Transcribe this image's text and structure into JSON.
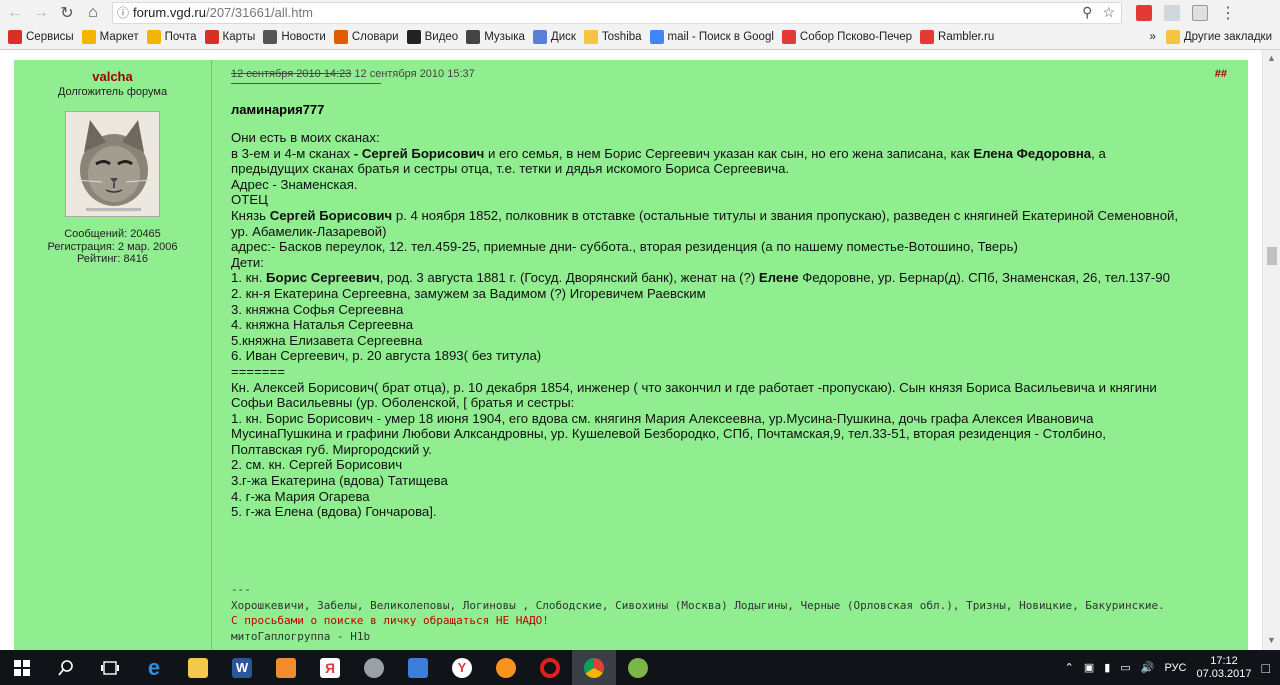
{
  "browser": {
    "url_host": "forum.vgd.ru",
    "url_path": "/207/31661/all.htm"
  },
  "bookmarks": [
    {
      "label": "Сервисы",
      "color": "#d93025"
    },
    {
      "label": "Маркет",
      "color": "#f4b400"
    },
    {
      "label": "Почта",
      "color": "#f4b400"
    },
    {
      "label": "Карты",
      "color": "#d93025"
    },
    {
      "label": "Новости",
      "color": "#555555"
    },
    {
      "label": "Словари",
      "color": "#e05a00"
    },
    {
      "label": "Видео",
      "color": "#222222"
    },
    {
      "label": "Музыка",
      "color": "#444444"
    },
    {
      "label": "Диск",
      "color": "#5a7fd6"
    },
    {
      "label": "Toshiba",
      "color": "#f6c443"
    },
    {
      "label": "mail - Поиск в Googl",
      "color": "#4285f4"
    },
    {
      "label": "Собор Псково-Печер",
      "color": "#e53935"
    },
    {
      "label": "Rambler.ru",
      "color": "#e53935"
    }
  ],
  "bookmarks_more": "»",
  "other_bookmarks": "Другие закладки",
  "post": {
    "username": "valcha",
    "user_title": "Долгожитель форума",
    "stats": {
      "messages": "Сообщений: 20465",
      "registration": "Регистрация: 2 мар. 2006",
      "rating": "Рейтинг: 8416"
    },
    "date_old": "12 сентября 2010 14:23",
    "date_new": "12 сентября 2010 15:37",
    "anchor": "##",
    "quote_author": "ламинария777",
    "lines": [
      "Они есть в моих сканах:",
      "в 3-ем и 4-м сканах - Сергей Борисович и его семья, в нем Борис Сергеевич указан как сын, но его жена записана, как Елена Федоровна, а",
      "предыдущих сканах братья и сестры отца, т.е. тетки и дядья искомого Бориса Сергеевича.",
      "Адрес - Знаменская.",
      "ОТЕЦ",
      "Князь Сергей Борисович р. 4 ноября 1852, полковник в отставке (остальные титулы и звания пропускаю), разведен с княгиней Екатериной Семеновной,",
      "ур. Абамелик-Лазаревой)",
      "адрес:- Басков переулок, 12. тел.459-25, приемные дни- суббота., вторая резиденция (а по нашему поместье-Вотошино, Тверь)",
      "Дети:",
      "1. кн. Борис Сергеевич, род. 3 августа 1881 г. (Госуд. Дворянский банк), женат на (?) Елене Федоровне, ур. Бернар(д). СПб, Знаменская, 26, тел.137-90",
      "2. кн-я Екатерина Сергеевна, замужем за Вадимом (?) Игоревичем Раевским",
      "3. княжна Софья Сергеевна",
      "4. княжна Наталья Сергеевна",
      "5.княжна Елизавета Сергеевна",
      "6. Иван Сергеевич, р. 20 августа 1893( без титула)",
      "=======",
      "Кн. Алексей Борисович( брат отца), р. 10 декабря 1854, инженер ( что закончил и где работает -пропускаю). Сын князя Бориса Васильевича и княгини",
      "Софьи Васильевны (ур. Оболенской, [ братья и сестры:",
      "1. кн. Борис Борисович - умер 18 июня 1904, его вдова см. княгиня Мария Алексеевна, ур.Мусина-Пушкина, дочь графа Алексея Ивановича",
      "МусинаПушкина и графини Любови Алксандровны, ур. Кушелевой Безбородко, СПб, Почтамская,9, тел.33-51, вторая резиденция - Столбино,",
      "Полтавская губ. Миргородский у.",
      "2. см. кн. Сергей Борисович",
      "3.г-жа Екатерина (вдова) Татищева",
      "4. г-жа Мария Огарева",
      "5. г-жа Елена (вдова) Гончарова]."
    ],
    "signature": {
      "dashes": "---",
      "surnames": "Хорошкевичи, Забелы, Великолеповы, Логиновы , Слободские, Сивохины (Москва) Лодыгины, Черные (Орловская обл.), Тризны, Новицкие, Бакуринские.",
      "warning": "С просьбами о поиске в личку обращаться НЕ НАДО!",
      "haplogroup": "митоГаплогруппа - H1b"
    }
  },
  "taskbar": {
    "language": "РУС",
    "time": "17:12",
    "date": "07.03.2017"
  },
  "colors": {
    "post_bg": "#90ee90",
    "username": "#a00000",
    "warning": "#c00000"
  }
}
